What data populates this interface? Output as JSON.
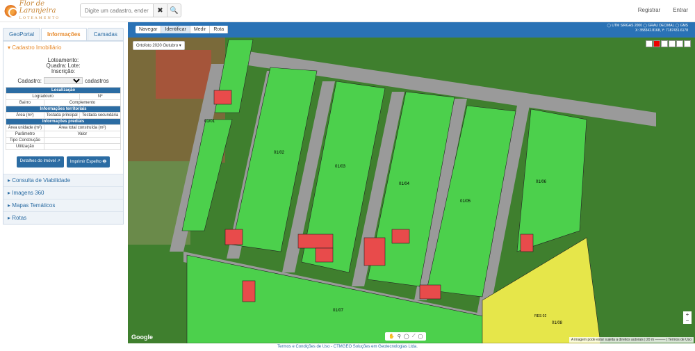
{
  "header": {
    "logo_text": "Flor de Laranjeira",
    "logo_sub": "LOTEAMENTO",
    "search_placeholder": "Digite um cadastro, endereço",
    "clear_icon": "✖",
    "search_icon": "🔍",
    "register": "Registrar",
    "login": "Entrar"
  },
  "left": {
    "tabs": [
      "GeoPortal",
      "Informações",
      "Camadas"
    ],
    "cadastro_title": "Cadastro Imobiliário",
    "loteamento": "Loteamento:",
    "quadra": "Quadra:",
    "lote": "Lote:",
    "inscricao": "Inscrição:",
    "cadastro": "Cadastro:",
    "cadastros": "cadastros",
    "loc_title": "Localização",
    "logradouro": "Logradouro",
    "numero": "Nº",
    "bairro": "Bairro",
    "complemento": "Complemento",
    "terr_title": "Informações territoriais",
    "area": "Área (m²)",
    "testada_p": "Testada principal",
    "testada_s": "Testada secundária",
    "pred_title": "Informações prediais",
    "area_unid": "Área unidade (m²)",
    "area_total": "Área total construída (m²)",
    "parametro": "Parâmetro",
    "valor": "Valor",
    "tipo": "Tipo Construção",
    "utilizacao": "Utilização",
    "btn_detalhes": "Detalhes do Imóvel ↗",
    "btn_imprimir": "Imprimir Espelho 🖶",
    "acc": [
      "Consulta de Viabilidade",
      "Imagens 360",
      "Mapas Temáticos",
      "Rotas"
    ]
  },
  "map": {
    "buttons": [
      "Navegar",
      "Identificar",
      "Medir",
      "Rota"
    ],
    "proj": "◯ UTM SIRGAS 2000 ◯ GRAU DECIMAL ◯ GMS",
    "coords": "X: 358342.8168, Y: 7187431.6178",
    "layer": "Ortofoto 2020 Outubro ▾",
    "attrib": "A imagem pode estar sujeita a direitos autorais | 20 m ——— | Termos de Uso",
    "google": "Google",
    "block_labels": [
      "01/01",
      "01/02",
      "01/03",
      "01/04",
      "01/05",
      "01/06",
      "01/07",
      "01/08"
    ],
    "res": "RES 02"
  },
  "footer": "Termos e Condições de Uso - CTMGEO Soluções em Geotecnologias Ltda."
}
